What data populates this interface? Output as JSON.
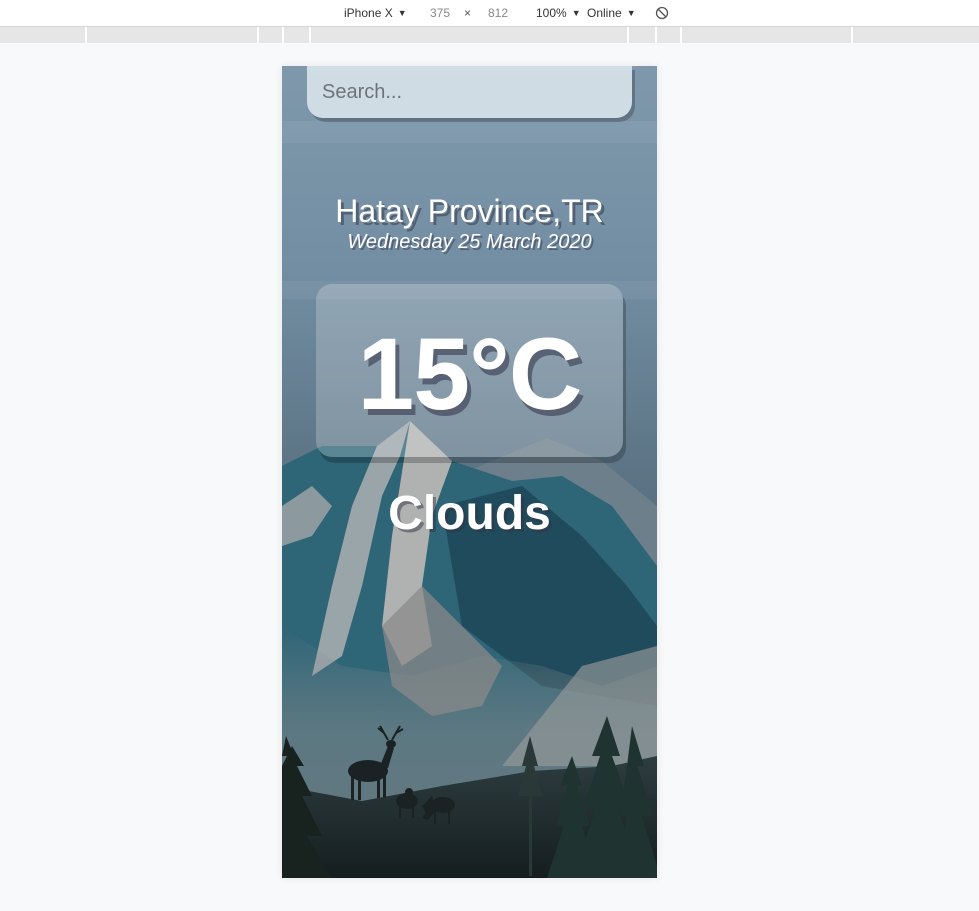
{
  "devtools": {
    "device": "iPhone X",
    "width": "375",
    "times": "×",
    "height": "812",
    "zoom": "100%",
    "network": "Online"
  },
  "weather": {
    "search_placeholder": "Search...",
    "location": "Hatay Province,TR",
    "date": "Wednesday 25 March 2020",
    "temperature": "15°C",
    "condition": "Clouds"
  },
  "icons": {
    "rotate": "rotate-icon",
    "dropdown": "caret-down-icon"
  }
}
